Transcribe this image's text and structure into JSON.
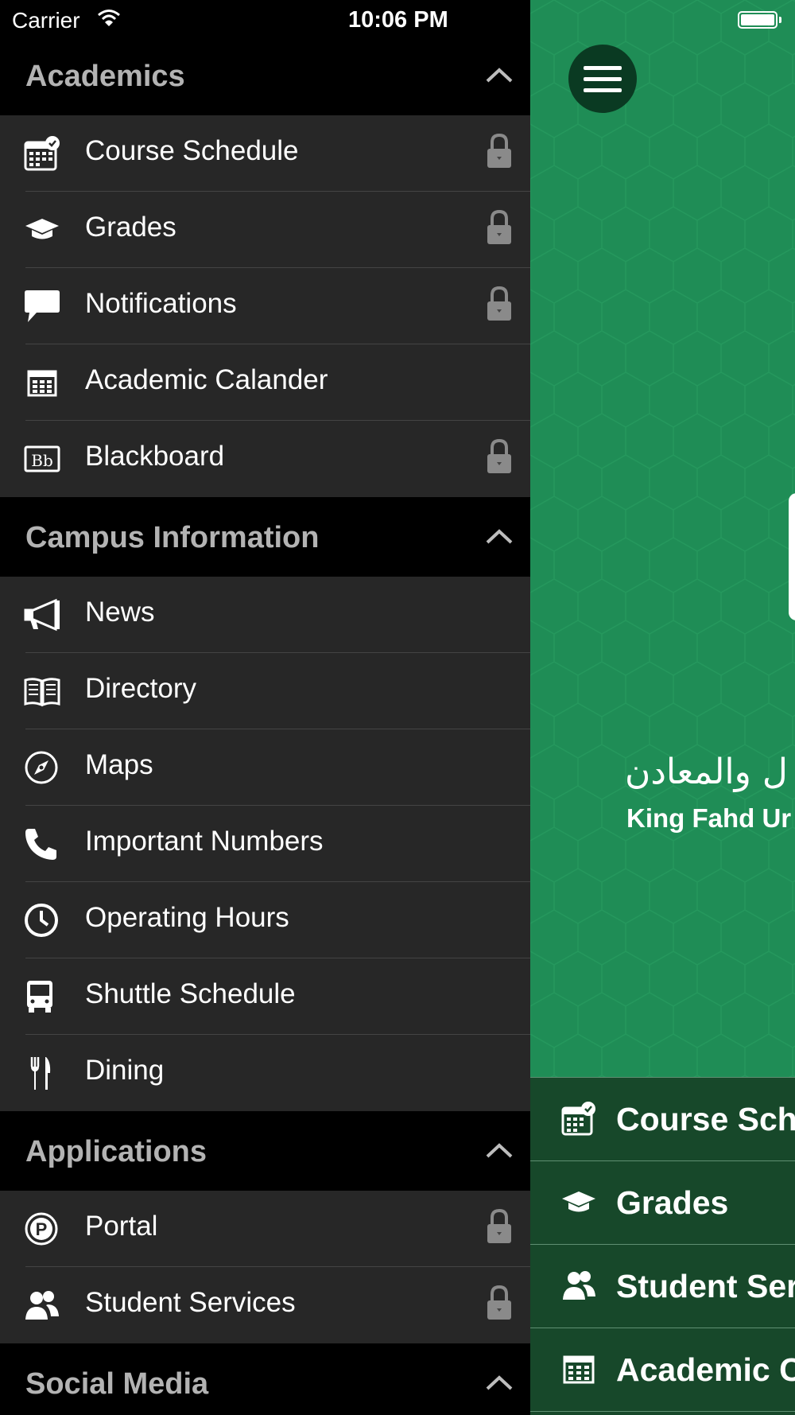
{
  "status_bar": {
    "carrier": "Carrier",
    "time": "10:06 PM"
  },
  "sections": {
    "academics": {
      "title": "Academics",
      "items": [
        {
          "label": "Course Schedule",
          "icon": "calendar-check-icon",
          "locked": true
        },
        {
          "label": "Grades",
          "icon": "graduation-cap-icon",
          "locked": true
        },
        {
          "label": "Notifications",
          "icon": "speech-bubble-icon",
          "locked": true
        },
        {
          "label": "Academic Calander",
          "icon": "calendar-grid-icon",
          "locked": false
        },
        {
          "label": "Blackboard",
          "icon": "blackboard-logo-icon",
          "locked": true
        }
      ]
    },
    "campus": {
      "title": "Campus Information",
      "items": [
        {
          "label": "News",
          "icon": "megaphone-icon",
          "locked": false
        },
        {
          "label": "Directory",
          "icon": "open-book-icon",
          "locked": false
        },
        {
          "label": "Maps",
          "icon": "compass-icon",
          "locked": false
        },
        {
          "label": "Important Numbers",
          "icon": "phone-icon",
          "locked": false
        },
        {
          "label": "Operating Hours",
          "icon": "clock-icon",
          "locked": false
        },
        {
          "label": "Shuttle Schedule",
          "icon": "bus-icon",
          "locked": false
        },
        {
          "label": "Dining",
          "icon": "fork-knife-icon",
          "locked": false
        }
      ]
    },
    "applications": {
      "title": "Applications",
      "items": [
        {
          "label": "Portal",
          "icon": "portal-p-icon",
          "locked": true
        },
        {
          "label": "Student Services",
          "icon": "users-icon",
          "locked": true
        }
      ]
    },
    "social": {
      "title": "Social Media"
    }
  },
  "main": {
    "logo_arabic": "ل والمعادن",
    "logo_english": "King Fahd Ur",
    "quick_links": [
      {
        "label": "Course Sche",
        "icon": "calendar-check-icon"
      },
      {
        "label": "Grades",
        "icon": "graduation-cap-icon"
      },
      {
        "label": "Student Serv",
        "icon": "users-icon"
      },
      {
        "label": "Academic Ca",
        "icon": "calendar-grid-icon"
      }
    ]
  },
  "colors": {
    "drawer_bg": "#000000",
    "item_bg": "#272727",
    "section_title": "#b3b3b3",
    "main_green": "#1f8d56",
    "quick_bg": "#17482a"
  }
}
